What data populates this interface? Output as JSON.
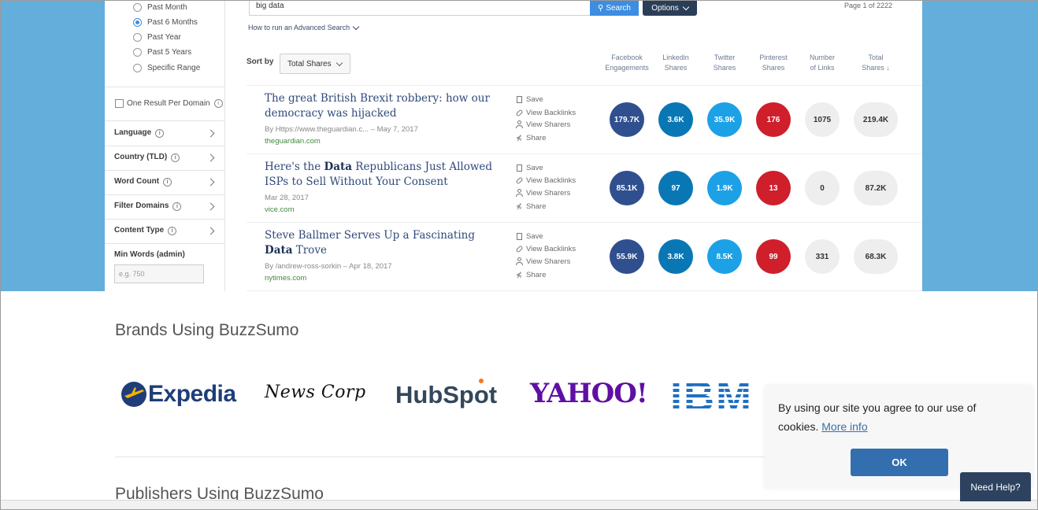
{
  "colors": {
    "hero_bg": "#64aedb",
    "facebook": "#2f4f8f",
    "linkedin": "#0a77b5",
    "twitter": "#1da1e6",
    "pinterest": "#cf1f2b",
    "neutral_bubble": "#eeeeee",
    "search_button": "#3d8de0",
    "options_button": "#2b3e57",
    "cookie_ok": "#336fae",
    "help_button": "#2d425e"
  },
  "sidebar": {
    "date_options": [
      {
        "label": "Past Month",
        "checked": false
      },
      {
        "label": "Past 6 Months",
        "checked": true
      },
      {
        "label": "Past Year",
        "checked": false
      },
      {
        "label": "Past 5 Years",
        "checked": false
      },
      {
        "label": "Specific Range",
        "checked": false
      }
    ],
    "one_result_per_domain": "One Result Per Domain",
    "filters": [
      {
        "label": "Language"
      },
      {
        "label": "Country (TLD)"
      },
      {
        "label": "Word Count"
      },
      {
        "label": "Filter Domains"
      },
      {
        "label": "Content Type"
      }
    ],
    "min_words_label": "Min Words (admin)",
    "min_words_placeholder": "e.g. 750"
  },
  "search": {
    "query": "big data",
    "button_label": "Search",
    "options_label": "Options",
    "page_count": "Page 1 of 2222",
    "advanced_link": "How to run an Advanced Search"
  },
  "sort": {
    "label": "Sort by",
    "selected": "Total Shares"
  },
  "columns": [
    {
      "line1": "Facebook",
      "line2": "Engagements"
    },
    {
      "line1": "Linkedin",
      "line2": "Shares"
    },
    {
      "line1": "Twitter",
      "line2": "Shares"
    },
    {
      "line1": "Pinterest",
      "line2": "Shares"
    },
    {
      "line1": "Number",
      "line2": "of Links"
    },
    {
      "line1": "Total",
      "line2": "Shares ↓"
    }
  ],
  "actions": {
    "save": "Save",
    "backlinks": "View Backlinks",
    "sharers": "View Sharers",
    "share": "Share"
  },
  "results": [
    {
      "title_pre": "The great British Brexit robbery: how our democracy was hijacked",
      "title_bold": "",
      "title_post": "",
      "meta": "By Https://www.theguardian.c... – May 7, 2017",
      "domain": "theguardian.com",
      "facebook": "179.7K",
      "linkedin": "3.6K",
      "twitter": "35.9K",
      "pinterest": "176",
      "links": "1075",
      "total": "219.4K"
    },
    {
      "title_pre": "Here's the ",
      "title_bold": "Data",
      "title_post": " Republicans Just Allowed ISPs to Sell Without Your Consent",
      "meta": "Mar 28, 2017",
      "domain": "vice.com",
      "facebook": "85.1K",
      "linkedin": "97",
      "twitter": "1.9K",
      "pinterest": "13",
      "links": "0",
      "total": "87.2K"
    },
    {
      "title_pre": "Steve Ballmer Serves Up a Fascinating ",
      "title_bold": "Data",
      "title_post": " Trove",
      "meta": "By /andrew-ross-sorkin – Apr 18, 2017",
      "domain": "nytimes.com",
      "facebook": "55.9K",
      "linkedin": "3.8K",
      "twitter": "8.5K",
      "pinterest": "99",
      "links": "331",
      "total": "68.3K"
    }
  ],
  "brands": {
    "title": "Brands Using BuzzSumo",
    "logos": [
      "Expedia",
      "News Corp",
      "HubSpot",
      "YAHOO!",
      "IBM"
    ]
  },
  "publishers": {
    "title": "Publishers Using BuzzSumo"
  },
  "cookie": {
    "text": "By using our site you agree to our use of cookies.",
    "link": "More info",
    "ok": "OK"
  },
  "help": {
    "label": "Need Help?"
  }
}
